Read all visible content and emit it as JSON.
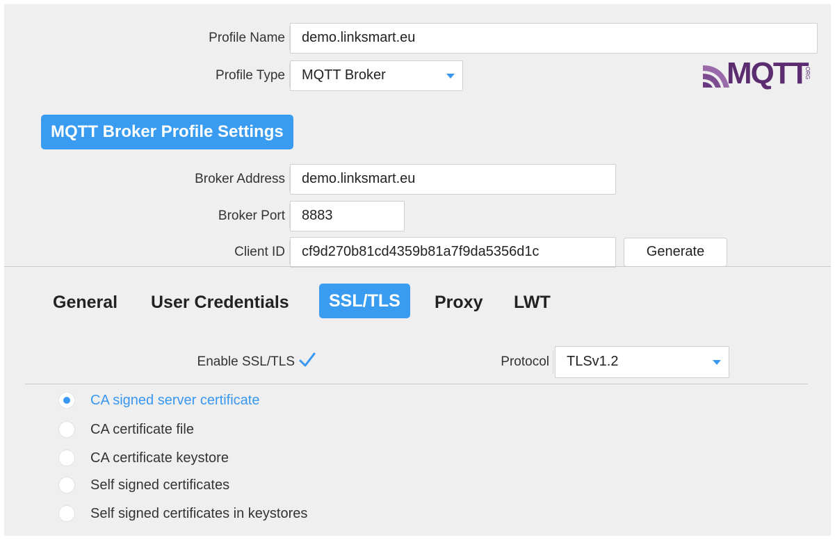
{
  "profile": {
    "name_label": "Profile Name",
    "name_value": "demo.linksmart.eu",
    "type_label": "Profile Type",
    "type_value": "MQTT Broker"
  },
  "logo": {
    "text": "MQTT",
    "suffix": "ORG",
    "icon": "mqtt-logo"
  },
  "section_title": "MQTT Broker Profile Settings",
  "broker": {
    "address_label": "Broker Address",
    "address_value": "demo.linksmart.eu",
    "port_label": "Broker Port",
    "port_value": "8883",
    "client_id_label": "Client ID",
    "client_id_value": "cf9d270b81cd4359b81a7f9da5356d1c",
    "generate_label": "Generate"
  },
  "tabs": [
    {
      "label": "General",
      "active": false
    },
    {
      "label": "User Credentials",
      "active": false
    },
    {
      "label": "SSL/TLS",
      "active": true
    },
    {
      "label": "Proxy",
      "active": false
    },
    {
      "label": "LWT",
      "active": false
    }
  ],
  "ssl": {
    "enable_label": "Enable SSL/TLS",
    "enabled": true,
    "protocol_label": "Protocol",
    "protocol_value": "TLSv1.2"
  },
  "cert_options": [
    {
      "label": "CA signed server certificate",
      "selected": true
    },
    {
      "label": "CA certificate file",
      "selected": false
    },
    {
      "label": "CA certificate keystore",
      "selected": false
    },
    {
      "label": "Self signed certificates",
      "selected": false
    },
    {
      "label": "Self signed certificates in keystores",
      "selected": false
    }
  ],
  "colors": {
    "accent": "#3a9cf0",
    "panel_bg": "#efefef",
    "field_bg": "#ffffff",
    "logo_purple": "#5b2c6f"
  }
}
